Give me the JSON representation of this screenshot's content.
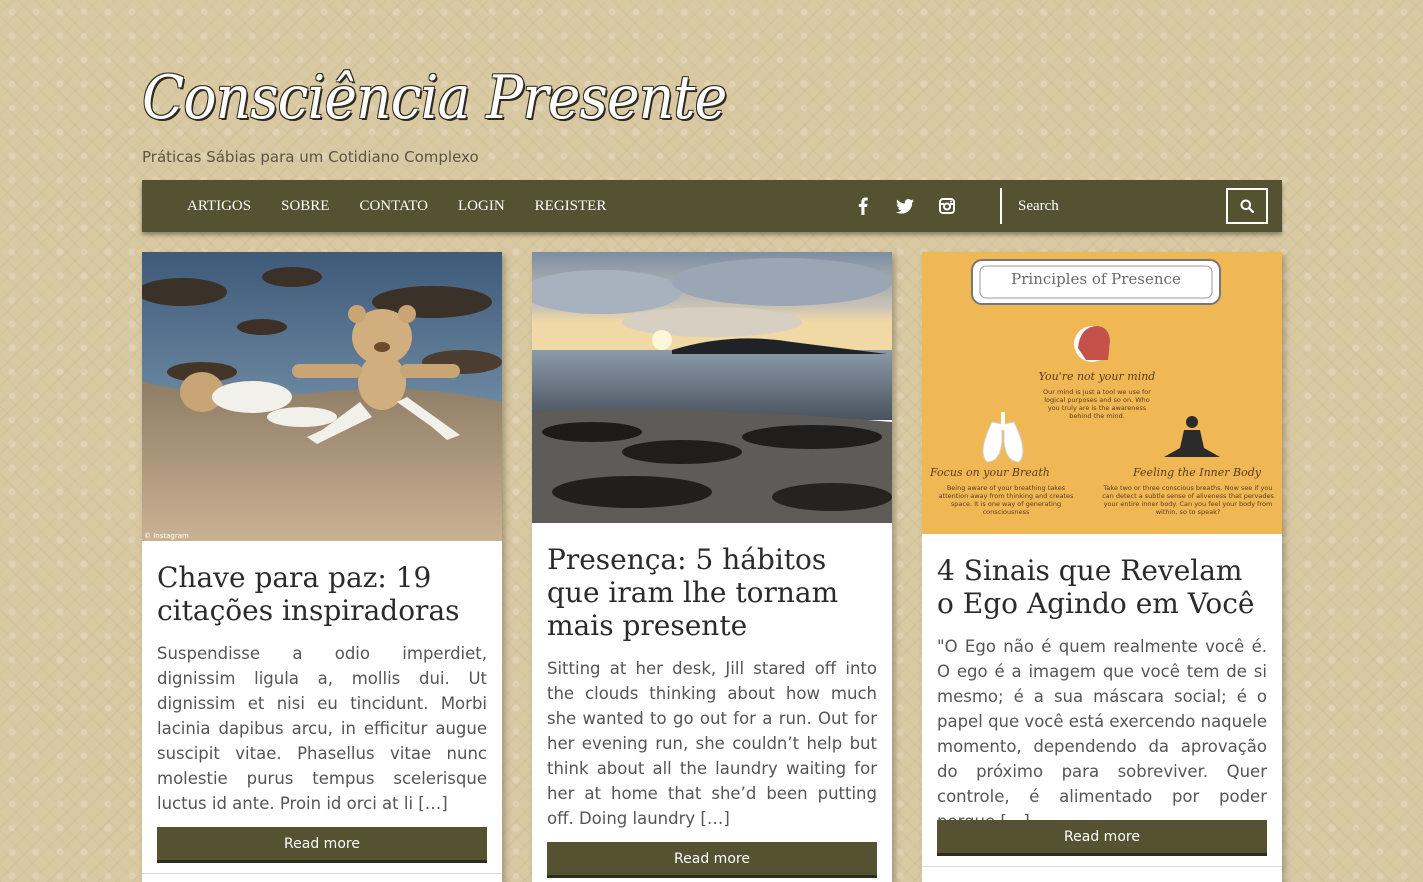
{
  "site": {
    "logo_text": "Consciência Presente",
    "tagline": "Práticas Sábias para um Cotidiano Complexo"
  },
  "nav": {
    "items": [
      "ARTIGOS",
      "SOBRE",
      "CONTATO",
      "LOGIN",
      "REGISTER"
    ],
    "social": [
      "facebook-icon",
      "twitter-icon",
      "instagram-icon"
    ],
    "search_placeholder": "Search"
  },
  "posts": [
    {
      "title": "Chave para paz: 19 citações inspiradoras",
      "excerpt": "Suspendisse a odio imperdiet, dignissim ligula a, mollis dui. Ut dignissim et nisi eu tincidunt. Morbi lacinia dapibus arcu, in efficitur augue suscipit vitae. Phasellus vitae nunc molestie purus tempus scelerisque luctus id ante. Proin id orci at li […]",
      "read_more": "Read more",
      "image_credit": "© Instagram"
    },
    {
      "title": "Presença: 5 hábitos que iram lhe tornam mais presente",
      "excerpt": "Sitting at her desk, Jill stared off into the clouds thinking about how much she wanted to go out for a run. Out for her evening run, she couldn’t help but think about all the laundry waiting for her at home that she’d been putting off. Doing laundry […]",
      "read_more": "Read more"
    },
    {
      "title": "4 Sinais que Revelam o Ego Agindo em Você",
      "excerpt": "\"O Ego não é quem realmente você é. O ego é a imagem que você tem de si mesmo; é a sua máscara social; é o papel que você está exercendo naquele momento, dependendo da aprovação do próximo para sobreviver. Quer controle, é alimentado por poder porque […]",
      "read_more": "Read more",
      "infographic": {
        "title": "Principles of Presence",
        "mind_heading": "You're not your mind",
        "mind_text": "Our mind is just a tool we use for logical purposes and so on. Who you truly are is the awareness behind the mind.",
        "breath_heading": "Focus on your Breath",
        "breath_text": "Being aware of your breathing takes attention away from thinking and creates space. It is one way of generating consciousness",
        "body_heading": "Feeling the Inner Body",
        "body_text": "Take two or three conscious breaths. Now see if you can detect a subtle sense of aliveness that pervades your entire inner body. Can you feel your body from within, so to speak?"
      }
    }
  ],
  "colors": {
    "nav_bg": "#545231",
    "page_bg": "#d9c9a3",
    "infographic_bg": "#f0b755"
  }
}
